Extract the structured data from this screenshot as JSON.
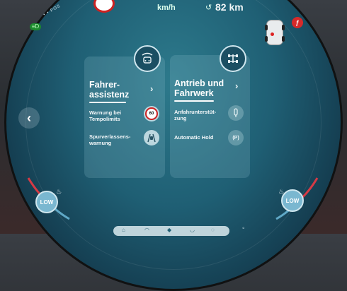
{
  "status_bar": {
    "speed_limit": "",
    "speed_unit": "km/h",
    "range_icon": "battery-range-icon",
    "range": "82 km",
    "drive_mode_dots": "• • POS"
  },
  "indicators": {
    "light": "low-beam-indicator-icon",
    "car_status": "vehicle-door-status-icon",
    "warning_badge": "ƒ"
  },
  "cards": [
    {
      "title": "Fahrer-\nassistenz",
      "icon": "driver-assist-car-icon",
      "rows": [
        {
          "label": "Warnung bei\nTempolimits",
          "icon": "speed-limit-60-icon",
          "icon_text": "60"
        },
        {
          "label": "Spurverlassens-\nwarnung",
          "icon": "lane-departure-icon",
          "icon_text": ""
        }
      ]
    },
    {
      "title": "Antrieb und\nFahrwerk",
      "icon": "drivetrain-icon",
      "rows": [
        {
          "label": "Anfahrunterstüt-\nzung",
          "icon": "hill-start-icon",
          "icon_text": ""
        },
        {
          "label": "Automatic Hold",
          "icon": "auto-hold-icon",
          "icon_text": "(P)"
        }
      ]
    }
  ],
  "controls": {
    "back": "‹",
    "temp_left": "LOW",
    "temp_right": "LOW"
  },
  "colors": {
    "screen_center": "#2d7a8c",
    "screen_edge": "#0e2a3a",
    "accent_red": "#d62a2a",
    "light_green": "#1c8a2e"
  }
}
